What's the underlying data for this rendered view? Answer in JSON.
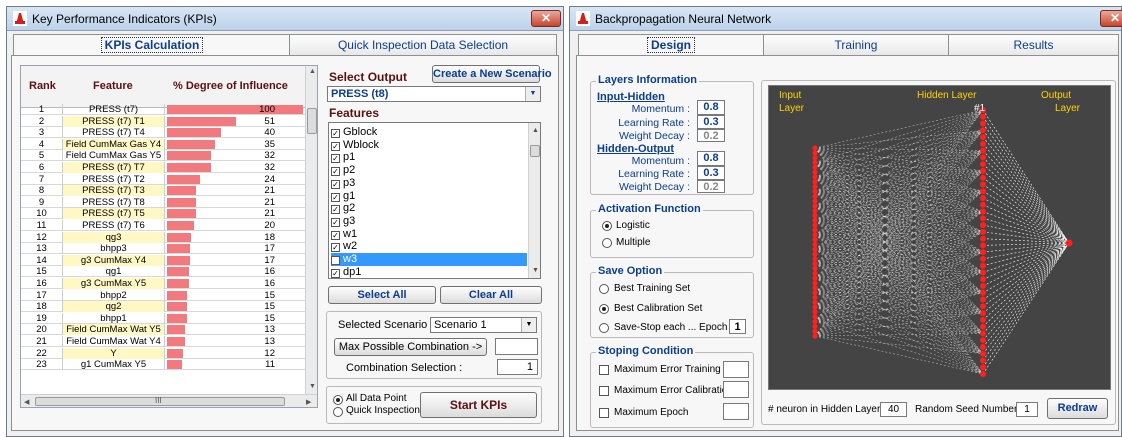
{
  "kpi_window": {
    "title": "Key Performance Indicators (KPIs)",
    "close": "✕",
    "tabs": [
      {
        "label": "KPIs Calculation",
        "active": true
      },
      {
        "label": "Quick Inspection Data Selection",
        "active": false
      }
    ],
    "table": {
      "headers": {
        "rank": "Rank",
        "feature": "Feature",
        "influence": "% Degree of Influence"
      },
      "rows": [
        {
          "rank": "1",
          "feature": "PRESS (t7)",
          "value": 100,
          "highlight": false
        },
        {
          "rank": "2",
          "feature": "PRESS (t7) T1",
          "value": 51,
          "highlight": true
        },
        {
          "rank": "3",
          "feature": "PRESS (t7) T4",
          "value": 40,
          "highlight": false
        },
        {
          "rank": "4",
          "feature": "Field CumMax Gas Y4",
          "value": 35,
          "highlight": true
        },
        {
          "rank": "5",
          "feature": "Field CumMax Gas Y5",
          "value": 32,
          "highlight": false
        },
        {
          "rank": "6",
          "feature": "PRESS (t7) T7",
          "value": 32,
          "highlight": true
        },
        {
          "rank": "7",
          "feature": "PRESS (t7) T2",
          "value": 24,
          "highlight": false
        },
        {
          "rank": "8",
          "feature": "PRESS (t7) T3",
          "value": 21,
          "highlight": true
        },
        {
          "rank": "9",
          "feature": "PRESS (t7) T8",
          "value": 21,
          "highlight": false
        },
        {
          "rank": "10",
          "feature": "PRESS (t7) T5",
          "value": 21,
          "highlight": true
        },
        {
          "rank": "11",
          "feature": "PRESS (t7) T6",
          "value": 20,
          "highlight": false
        },
        {
          "rank": "12",
          "feature": "qg3",
          "value": 18,
          "highlight": true
        },
        {
          "rank": "13",
          "feature": "bhpp3",
          "value": 17,
          "highlight": false
        },
        {
          "rank": "14",
          "feature": "g3 CumMax Y4",
          "value": 17,
          "highlight": true
        },
        {
          "rank": "15",
          "feature": "qg1",
          "value": 16,
          "highlight": false
        },
        {
          "rank": "16",
          "feature": "g3 CumMax Y5",
          "value": 16,
          "highlight": true
        },
        {
          "rank": "17",
          "feature": "bhpp2",
          "value": 15,
          "highlight": false
        },
        {
          "rank": "18",
          "feature": "qg2",
          "value": 15,
          "highlight": true
        },
        {
          "rank": "19",
          "feature": "bhpp1",
          "value": 15,
          "highlight": false
        },
        {
          "rank": "20",
          "feature": "Field CumMax Wat Y5",
          "value": 13,
          "highlight": true
        },
        {
          "rank": "21",
          "feature": "Field CumMax Wat Y4",
          "value": 13,
          "highlight": false
        },
        {
          "rank": "22",
          "feature": "Y",
          "value": 12,
          "highlight": true
        },
        {
          "rank": "23",
          "feature": "g1 CumMax Y5",
          "value": 11,
          "highlight": false
        }
      ],
      "scroll_mid": "III"
    },
    "select_output_label": "Select Output",
    "create_scenario_button": "Create a New Scenario",
    "output_value": "PRESS (t8)",
    "features_label": "Features",
    "features": [
      {
        "name": "Gblock",
        "checked": true,
        "selected": false
      },
      {
        "name": "Wblock",
        "checked": true,
        "selected": false
      },
      {
        "name": "p1",
        "checked": true,
        "selected": false
      },
      {
        "name": "p2",
        "checked": true,
        "selected": false
      },
      {
        "name": "p3",
        "checked": true,
        "selected": false
      },
      {
        "name": "g1",
        "checked": true,
        "selected": false
      },
      {
        "name": "g2",
        "checked": true,
        "selected": false
      },
      {
        "name": "g3",
        "checked": true,
        "selected": false
      },
      {
        "name": "w1",
        "checked": true,
        "selected": false
      },
      {
        "name": "w2",
        "checked": true,
        "selected": false
      },
      {
        "name": "w3",
        "checked": true,
        "selected": true
      },
      {
        "name": "dp1",
        "checked": true,
        "selected": false
      }
    ],
    "select_all_button": "Select All",
    "clear_all_button": "Clear All",
    "selected_scenario_label": "Selected Scenario :",
    "selected_scenario_value": "Scenario 1",
    "max_combination_button": "Max Possible Combination ->",
    "max_combination_value": "",
    "combination_selection_label": "Combination Selection :",
    "combination_selection_value": "1",
    "radio_all_data": "All Data Point",
    "radio_quick": "Quick Inspection",
    "start_kpis_button": "Start KPIs",
    "colors": {
      "bar": "#f2797e",
      "highlight": "#fff8c4"
    }
  },
  "nn_window": {
    "title": "Backpropagation Neural Network",
    "close": "✕",
    "tabs": [
      {
        "label": "Design",
        "active": true
      },
      {
        "label": "Training",
        "active": false
      },
      {
        "label": "Results",
        "active": false
      }
    ],
    "layers_info": {
      "title": "Layers Information",
      "input_hidden": "Input-Hidden",
      "hidden_output": "Hidden-Output",
      "momentum_label": "Momentum  :",
      "learning_rate_label": "Learning Rate  :",
      "weight_decay_label": "Weight Decay  :",
      "ih_momentum": "0.8",
      "ih_learning_rate": "0.3",
      "ih_weight_decay": "0.2",
      "ho_momentum": "0.8",
      "ho_learning_rate": "0.3",
      "ho_weight_decay": "0.2"
    },
    "activation": {
      "title": "Activation Function",
      "logistic": "Logistic",
      "multiple": "Multiple"
    },
    "save_option": {
      "title": "Save Option",
      "best_training": "Best Training Set",
      "best_calibration": "Best Calibration Set",
      "save_stop": "Save-Stop  each ... Epoch",
      "epoch_value": "1"
    },
    "stopping": {
      "title": "Stoping Condition",
      "max_error_training": "Maximum Error Training",
      "max_error_calibration": "Maximum Error Calibration",
      "max_epoch": "Maximum Epoch"
    },
    "diagram": {
      "input_label_1": "Input",
      "input_label_2": "Layer",
      "hidden_label": "Hidden Layer",
      "hidden_marker": "#1",
      "output_label_1": "Output",
      "output_label_2": "Layer",
      "input_nodes": 40,
      "hidden_nodes": 40,
      "node_color": "#ff2020",
      "edge_color": "#ffffff",
      "background": "#444444"
    },
    "neurons_label": "# neuron in Hidden Layer:",
    "neurons_value": "40",
    "seed_label": "Random Seed Number:",
    "seed_value": "1",
    "redraw_button": "Redraw"
  }
}
